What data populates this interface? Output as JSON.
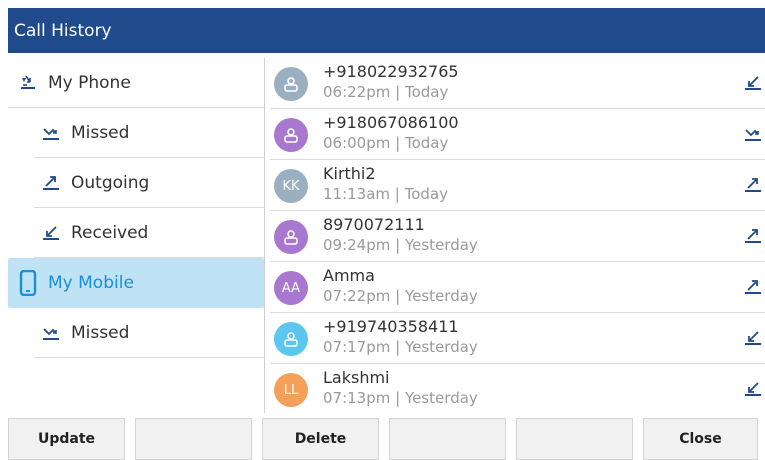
{
  "title": "Call History",
  "sidebar": {
    "items": [
      {
        "label": "My Phone",
        "icon": "phone-log-icon",
        "level": "top",
        "selected": false
      },
      {
        "label": "Missed",
        "icon": "missed-call-icon",
        "level": "sub",
        "selected": false
      },
      {
        "label": "Outgoing",
        "icon": "outgoing-call-icon",
        "level": "sub",
        "selected": false
      },
      {
        "label": "Received",
        "icon": "received-call-icon",
        "level": "sub",
        "selected": false
      },
      {
        "label": "My Mobile",
        "icon": "mobile-phone-icon",
        "level": "top",
        "selected": true
      },
      {
        "label": "Missed",
        "icon": "missed-call-icon",
        "level": "sub",
        "selected": false
      }
    ]
  },
  "calls": [
    {
      "name": "+918022932765",
      "time": "06:22pm",
      "day": "Today",
      "avatar": "",
      "avatar_color": "#9ab0c0",
      "direction": "received"
    },
    {
      "name": "+918067086100",
      "time": "06:00pm",
      "day": "Today",
      "avatar": "",
      "avatar_color": "#a877d0",
      "direction": "missed"
    },
    {
      "name": "Kirthi2",
      "time": "11:13am",
      "day": "Today",
      "avatar": "KK",
      "avatar_color": "#9ab0c0",
      "direction": "outgoing"
    },
    {
      "name": "8970072111",
      "time": "09:24pm",
      "day": "Yesterday",
      "avatar": "",
      "avatar_color": "#a877d0",
      "direction": "outgoing"
    },
    {
      "name": "Amma",
      "time": "07:22pm",
      "day": "Yesterday",
      "avatar": "AA",
      "avatar_color": "#a877d0",
      "direction": "outgoing"
    },
    {
      "name": "+919740358411",
      "time": "07:17pm",
      "day": "Yesterday",
      "avatar": "",
      "avatar_color": "#5cc6ef",
      "direction": "received"
    },
    {
      "name": "Lakshmi",
      "time": "07:13pm",
      "day": "Yesterday",
      "avatar": "LL",
      "avatar_color": "#f5a05a",
      "direction": "received"
    }
  ],
  "softkeys": [
    "Update",
    "",
    "Delete",
    "",
    "",
    "Close"
  ],
  "colors": {
    "titlebar": "#1f4a8c",
    "selected_bg": "#bfe2f5",
    "selected_text": "#1a8fd6",
    "icon_navy": "#1f4a8c"
  }
}
